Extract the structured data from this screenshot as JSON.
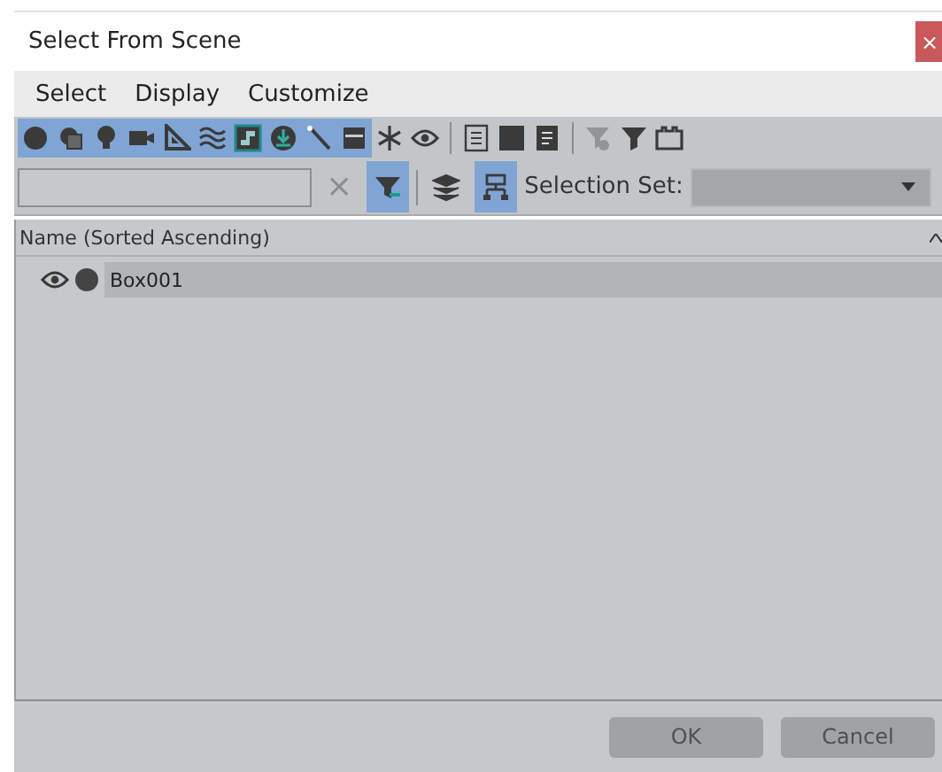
{
  "window": {
    "title": "Select From Scene",
    "close": "×"
  },
  "menu": [
    {
      "label": "Select"
    },
    {
      "label": "Display"
    },
    {
      "label": "Customize"
    }
  ],
  "toolbar": [
    {
      "kind": "button",
      "selected": true
    },
    {
      "kind": "button",
      "selected": true
    },
    {
      "kind": "button",
      "selected": true
    },
    {
      "kind": "button",
      "selected": true
    },
    {
      "kind": "button",
      "selected": true
    },
    {
      "kind": "button",
      "selected": true
    },
    {
      "kind": "button",
      "selected": true
    },
    {
      "kind": "button",
      "selected": true
    },
    {
      "kind": "button",
      "selected": true
    },
    {
      "kind": "button",
      "selected": true
    },
    {
      "kind": "button",
      "selected": false
    },
    {
      "kind": "button",
      "selected": false
    },
    {
      "kind": "separator"
    },
    {
      "kind": "button",
      "selected": false
    },
    {
      "kind": "button",
      "selected": false
    },
    {
      "kind": "button",
      "selected": false
    },
    {
      "kind": "separator"
    },
    {
      "kind": "button",
      "selected": false,
      "disabled": true
    },
    {
      "kind": "button",
      "selected": false
    },
    {
      "kind": "button",
      "selected": false
    }
  ],
  "filter_bar": {
    "clear": "×",
    "toggles": [
      {
        "selected": true
      },
      {
        "selected": false
      },
      {
        "selected": true
      }
    ],
    "selection_set_label": "Selection Set:"
  },
  "list": {
    "header": "Name (Sorted Ascending)",
    "rows": [
      {
        "name": "Box001",
        "visible": true,
        "selected": true
      }
    ]
  },
  "buttons": [
    {
      "label": "OK"
    },
    {
      "label": "Cancel"
    }
  ]
}
